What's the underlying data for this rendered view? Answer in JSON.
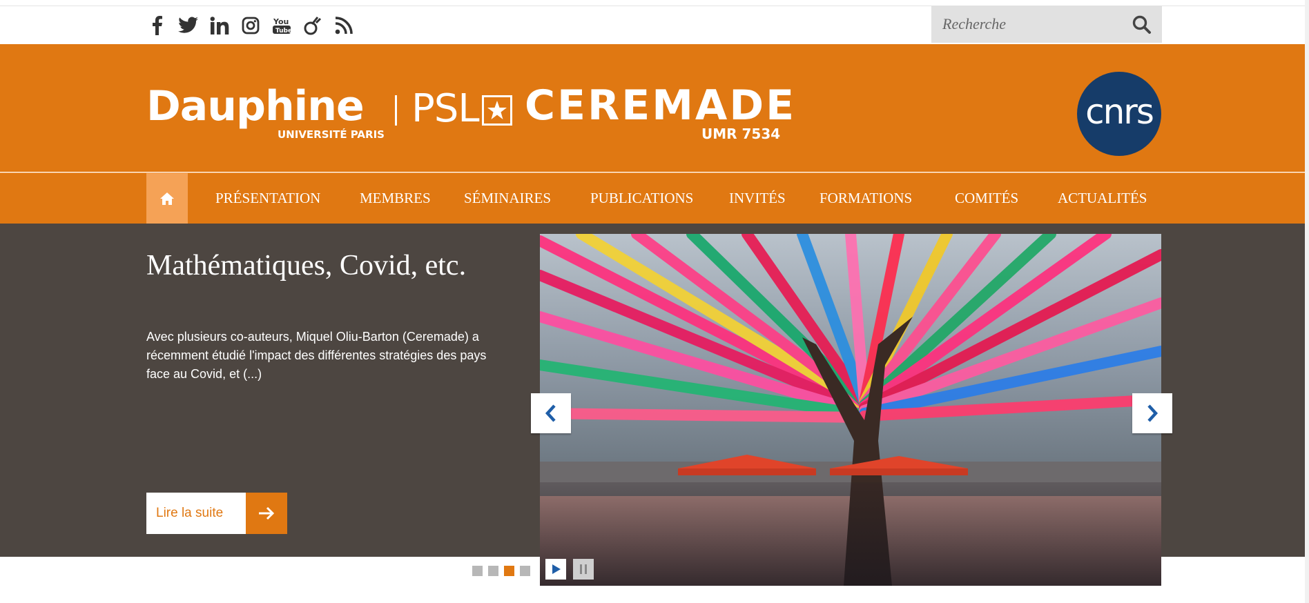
{
  "social": {
    "icons": [
      "facebook-icon",
      "twitter-icon",
      "linkedin-icon",
      "instagram-icon",
      "youtube-icon",
      "viadeo-icon",
      "rss-icon"
    ]
  },
  "search": {
    "placeholder": "Recherche"
  },
  "header": {
    "dauphine": "Dauphine",
    "universite": "UNIVERSITÉ PARIS",
    "psl": "PSL",
    "ceremade": "CEREMADE",
    "umr": "UMR 7534",
    "cnrs": "cnrs"
  },
  "nav": {
    "items": [
      {
        "label": "PRÉSENTATION"
      },
      {
        "label": "MEMBRES"
      },
      {
        "label": "SÉMINAIRES"
      },
      {
        "label": "PUBLICATIONS"
      },
      {
        "label": "INVITÉS"
      },
      {
        "label": "FORMATIONS"
      },
      {
        "label": "COMITÉS"
      },
      {
        "label": "ACTUALITÉS"
      }
    ]
  },
  "slide": {
    "title": "Mathématiques, Covid, etc.",
    "description": "Avec plusieurs co-auteurs, Miquel Oliu-Barton (Ceremade) a récemment étudié l'impact des différentes stratégies des pays face au Covid, et (...)",
    "read_more": "Lire la suite",
    "total_slides": 4,
    "active_slide": 3
  },
  "colors": {
    "brand_orange": "#e07812",
    "slider_bg": "#4d4641",
    "cnrs_blue": "#163c69"
  }
}
